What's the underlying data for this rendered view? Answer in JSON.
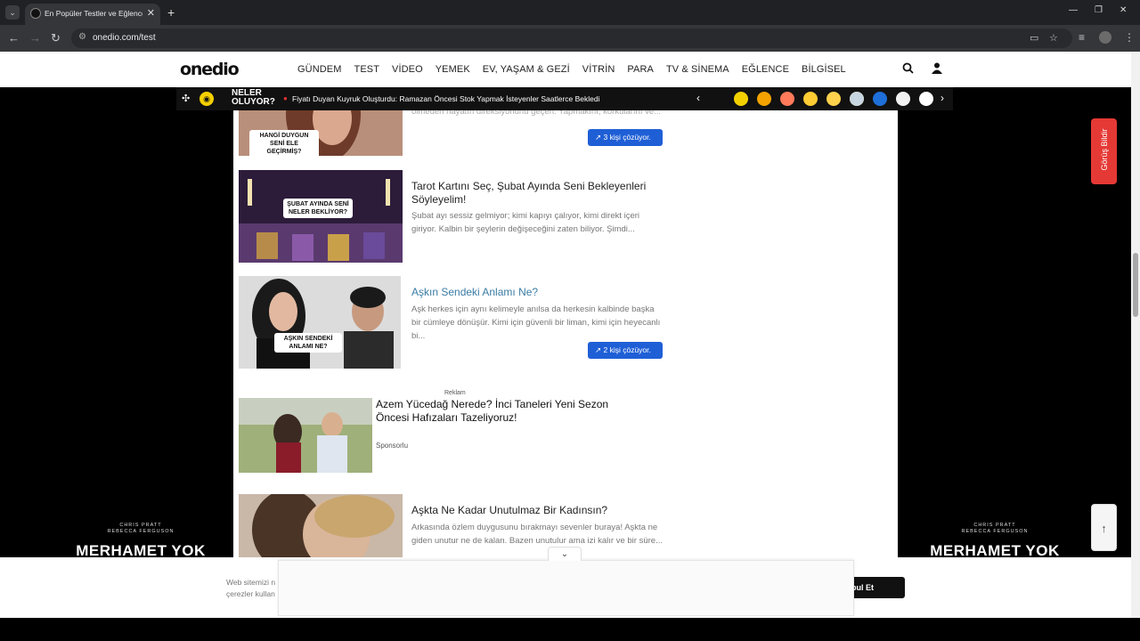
{
  "browser": {
    "tab_title": "En Popüler Testler ve Eğlenceli",
    "url": "onedio.com/test",
    "icons": [
      "tab-menu-icon",
      "close-icon",
      "new-tab-icon",
      "back-icon",
      "forward-icon",
      "reload-icon",
      "site-settings-icon",
      "cast-icon",
      "star-icon",
      "reading-list-icon",
      "profile-icon",
      "more-icon"
    ]
  },
  "header": {
    "logo": "onedio",
    "menu": [
      "GÜNDEM",
      "TEST",
      "VİDEO",
      "YEMEK",
      "EV, YAŞAM & GEZİ",
      "VİTRİN",
      "PARA",
      "TV & SİNEMA",
      "EĞLENCE",
      "BİLGİSEL"
    ]
  },
  "ticker": {
    "label_line1": "NELER",
    "label_line2": "OLUYOR?",
    "news": "Fiyatı Duyan Kuyruk Oluşturdu: Ramazan Öncesi Stok Yapmak İsteyenler Saatlerce Bekledi",
    "emojis": [
      "#f4d000",
      "#f4a300",
      "#ff7a5a",
      "#ffcc33",
      "#ffd24d",
      "#ffd24d",
      "#c7d6e0",
      "#1e6fd9",
      "#f2f2f2",
      "#ffffff"
    ]
  },
  "cards": [
    {
      "overlay": "HANGİ DUYGUN SENİ ELE GEÇİRMİŞ?",
      "desc_tail": "olmeden hayatın direksiyonunu geçen. Yapmakını, korkularını ve...",
      "badge": "3 kişi çözüyor."
    },
    {
      "overlay": "ŞUBAT AYINDA SENİ NELER BEKLİYOR?",
      "title": "Tarot Kartını Seç, Şubat Ayında Seni Bekleyenleri Söyleyelim!",
      "desc": "Şubat ayı sessiz gelmiyor; kimi kapıyı çalıyor, kimi direkt içeri giriyor. Kalbin bir şeylerin değişeceğini zaten biliyor. Şimdi..."
    },
    {
      "overlay": "AŞKIN SENDEKİ ANLAMI NE?",
      "title": "Aşkın Sendeki Anlamı Ne?",
      "desc": "Aşk herkes için aynı kelimeyle anılsa da herkesin kalbinde başka bir cümleye dönüşür. Kimi için güvenli bir liman, kimi için heyecanlı bi...",
      "badge": "2 kişi çözüyor."
    },
    {
      "title": "Aşkta Ne Kadar Unutulmaz Bir Kadınsın?",
      "desc": "Arkasında özlem duygusunu bırakmayı sevenler buraya! Aşkta ne giden unutur ne de kalan. Bazen unutulur ama izi kalır ve bir süre..."
    }
  ],
  "ad": {
    "label": "Reklam",
    "title": "Azem Yücedağ Nerede? İnci Taneleri Yeni Sezon Öncesi Hafızaları Tazeliyoruz!",
    "sponsored": "Sponsorlu"
  },
  "side_ad": {
    "credits_line1": "CHRIS PRATT",
    "credits_line2": "REBECCA FERGUSON",
    "title": "MERHAMET YOK"
  },
  "feedback": "Görüş Bildir",
  "cookie": {
    "text_line1": "Web sitemizi n",
    "text_line2": "çerezler kullan",
    "button": "bul Et"
  }
}
